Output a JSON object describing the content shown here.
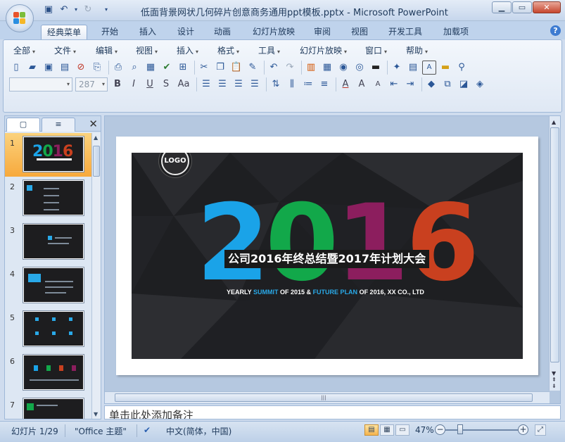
{
  "window": {
    "title": "低面背景网状几何碎片创意商务通用ppt模板.pptx - Microsoft PowerPoint",
    "controls": [
      "minimize",
      "maximize",
      "close"
    ]
  },
  "ribbon_tabs": [
    {
      "label": "经典菜单",
      "active": true
    },
    {
      "label": "开始"
    },
    {
      "label": "插入"
    },
    {
      "label": "设计"
    },
    {
      "label": "动画"
    },
    {
      "label": "幻灯片放映"
    },
    {
      "label": "审阅"
    },
    {
      "label": "视图"
    },
    {
      "label": "开发工具"
    },
    {
      "label": "加载项"
    }
  ],
  "classic_menu": [
    "全部",
    "文件",
    "编辑",
    "视图",
    "插入",
    "格式",
    "工具",
    "幻灯片放映",
    "窗口",
    "帮助"
  ],
  "font_box": {
    "font_name": "",
    "font_size": "287"
  },
  "left_pane": {
    "slides": [
      {
        "number": "1",
        "selected": true
      },
      {
        "number": "2"
      },
      {
        "number": "3"
      },
      {
        "number": "4"
      },
      {
        "number": "5"
      },
      {
        "number": "6"
      },
      {
        "number": "7"
      }
    ]
  },
  "slide": {
    "logo_text": "LOGO",
    "digits": [
      {
        "char": "2",
        "color": "#1aa3e8"
      },
      {
        "char": "0",
        "color": "#12a84a"
      },
      {
        "char": "1",
        "color": "#8c1e5e"
      },
      {
        "char": "6",
        "color": "#c9401f"
      }
    ],
    "headline": "公司2016年终总结暨2017年计划大会",
    "subline": {
      "part1": "YEARLY ",
      "hl1": "SUMMIT",
      "part2": " OF 2015 & ",
      "hl2": "FUTURE PLAN",
      "part3": " OF 2016, XX CO., LTD"
    },
    "background_color": "#1e1f22",
    "accent_color": "#29a9e8"
  },
  "notes": {
    "placeholder": "单击此处添加备注"
  },
  "status_bar": {
    "slide_info": "幻灯片 1/29",
    "theme": "\"Office 主题\"",
    "language": "中文(简体，中国)",
    "zoom": "47%"
  }
}
